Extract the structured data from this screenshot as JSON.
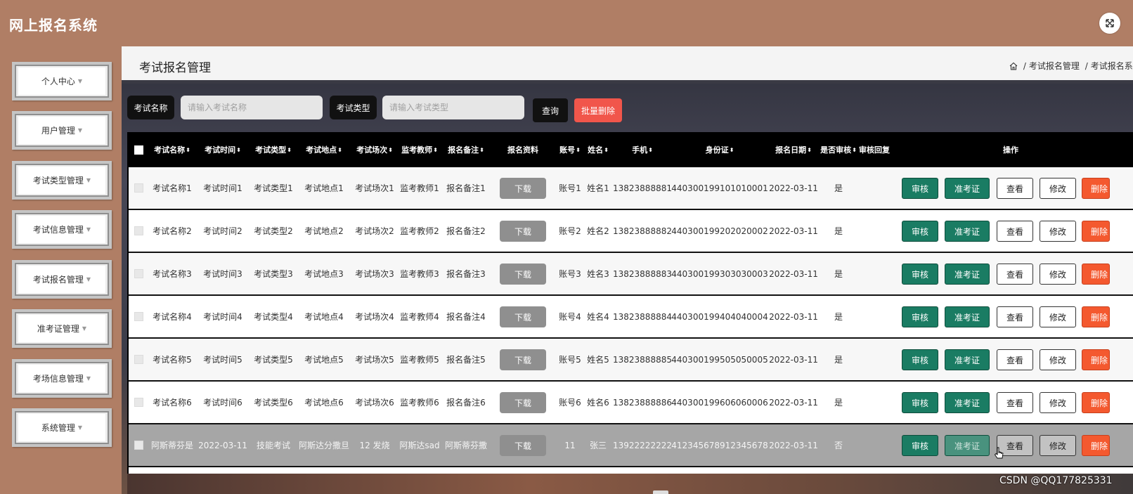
{
  "app": {
    "title": "网上报名系统"
  },
  "sidebar": {
    "items": [
      {
        "label": "个人中心"
      },
      {
        "label": "用户管理"
      },
      {
        "label": "考试类型管理"
      },
      {
        "label": "考试信息管理"
      },
      {
        "label": "考试报名管理"
      },
      {
        "label": "准考证管理"
      },
      {
        "label": "考场信息管理"
      },
      {
        "label": "系统管理"
      }
    ]
  },
  "page": {
    "title": "考试报名管理",
    "breadcrumb": [
      "考试报名管理",
      "考试报名系"
    ]
  },
  "search": {
    "name_label": "考试名称",
    "name_placeholder": "请输入考试名称",
    "type_label": "考试类型",
    "type_placeholder": "请输入考试类型",
    "query_label": "查询",
    "batch_delete_label": "批量删除"
  },
  "table": {
    "headers": [
      "考试名称",
      "考试时间",
      "考试类型",
      "考试地点",
      "考试场次",
      "监考教师",
      "报名备注",
      "报名资料",
      "账号",
      "姓名",
      "手机",
      "身份证",
      "报名日期",
      "是否审核",
      "审核回复",
      "操作"
    ],
    "actions": {
      "audit": "审核",
      "ticket": "准考证",
      "view": "查看",
      "edit": "修改",
      "delete": "删除"
    },
    "download_label": "下载",
    "rows": [
      [
        "考试名称1",
        "考试时间1",
        "考试类型1",
        "考试地点1",
        "考试场次1",
        "监考教师1",
        "报名备注1",
        "账号1",
        "姓名1",
        "13823888881",
        "440300199101010001",
        "2022-03-11",
        "是",
        ""
      ],
      [
        "考试名称2",
        "考试时间2",
        "考试类型2",
        "考试地点2",
        "考试场次2",
        "监考教师2",
        "报名备注2",
        "账号2",
        "姓名2",
        "13823888882",
        "440300199202020002",
        "2022-03-11",
        "是",
        ""
      ],
      [
        "考试名称3",
        "考试时间3",
        "考试类型3",
        "考试地点3",
        "考试场次3",
        "监考教师3",
        "报名备注3",
        "账号3",
        "姓名3",
        "13823888883",
        "440300199303030003",
        "2022-03-11",
        "是",
        ""
      ],
      [
        "考试名称4",
        "考试时间4",
        "考试类型4",
        "考试地点4",
        "考试场次4",
        "监考教师4",
        "报名备注4",
        "账号4",
        "姓名4",
        "13823888884",
        "440300199404040004",
        "2022-03-11",
        "是",
        ""
      ],
      [
        "考试名称5",
        "考试时间5",
        "考试类型5",
        "考试地点5",
        "考试场次5",
        "监考教师5",
        "报名备注5",
        "账号5",
        "姓名5",
        "13823888885",
        "440300199505050005",
        "2022-03-11",
        "是",
        ""
      ],
      [
        "考试名称6",
        "考试时间6",
        "考试类型6",
        "考试地点6",
        "考试场次6",
        "监考教师6",
        "报名备注6",
        "账号6",
        "姓名6",
        "13823888886",
        "440300199606060006",
        "2022-03-11",
        "是",
        ""
      ],
      [
        "阿斯蒂芬是",
        "2022-03-11",
        "技能考试",
        "阿斯达分撒旦",
        "12 发烧",
        "阿斯达sad",
        "阿斯蒂芬撒",
        "11",
        "张三",
        "13922222222",
        "412345678912345678",
        "2022-03-11",
        "否",
        ""
      ]
    ]
  },
  "watermark": "CSDN @QQ177825331",
  "icons": {
    "fullscreen": "expand-icon",
    "home": "home-icon",
    "sort": "sort-icon",
    "caret": "caret-down-icon"
  }
}
